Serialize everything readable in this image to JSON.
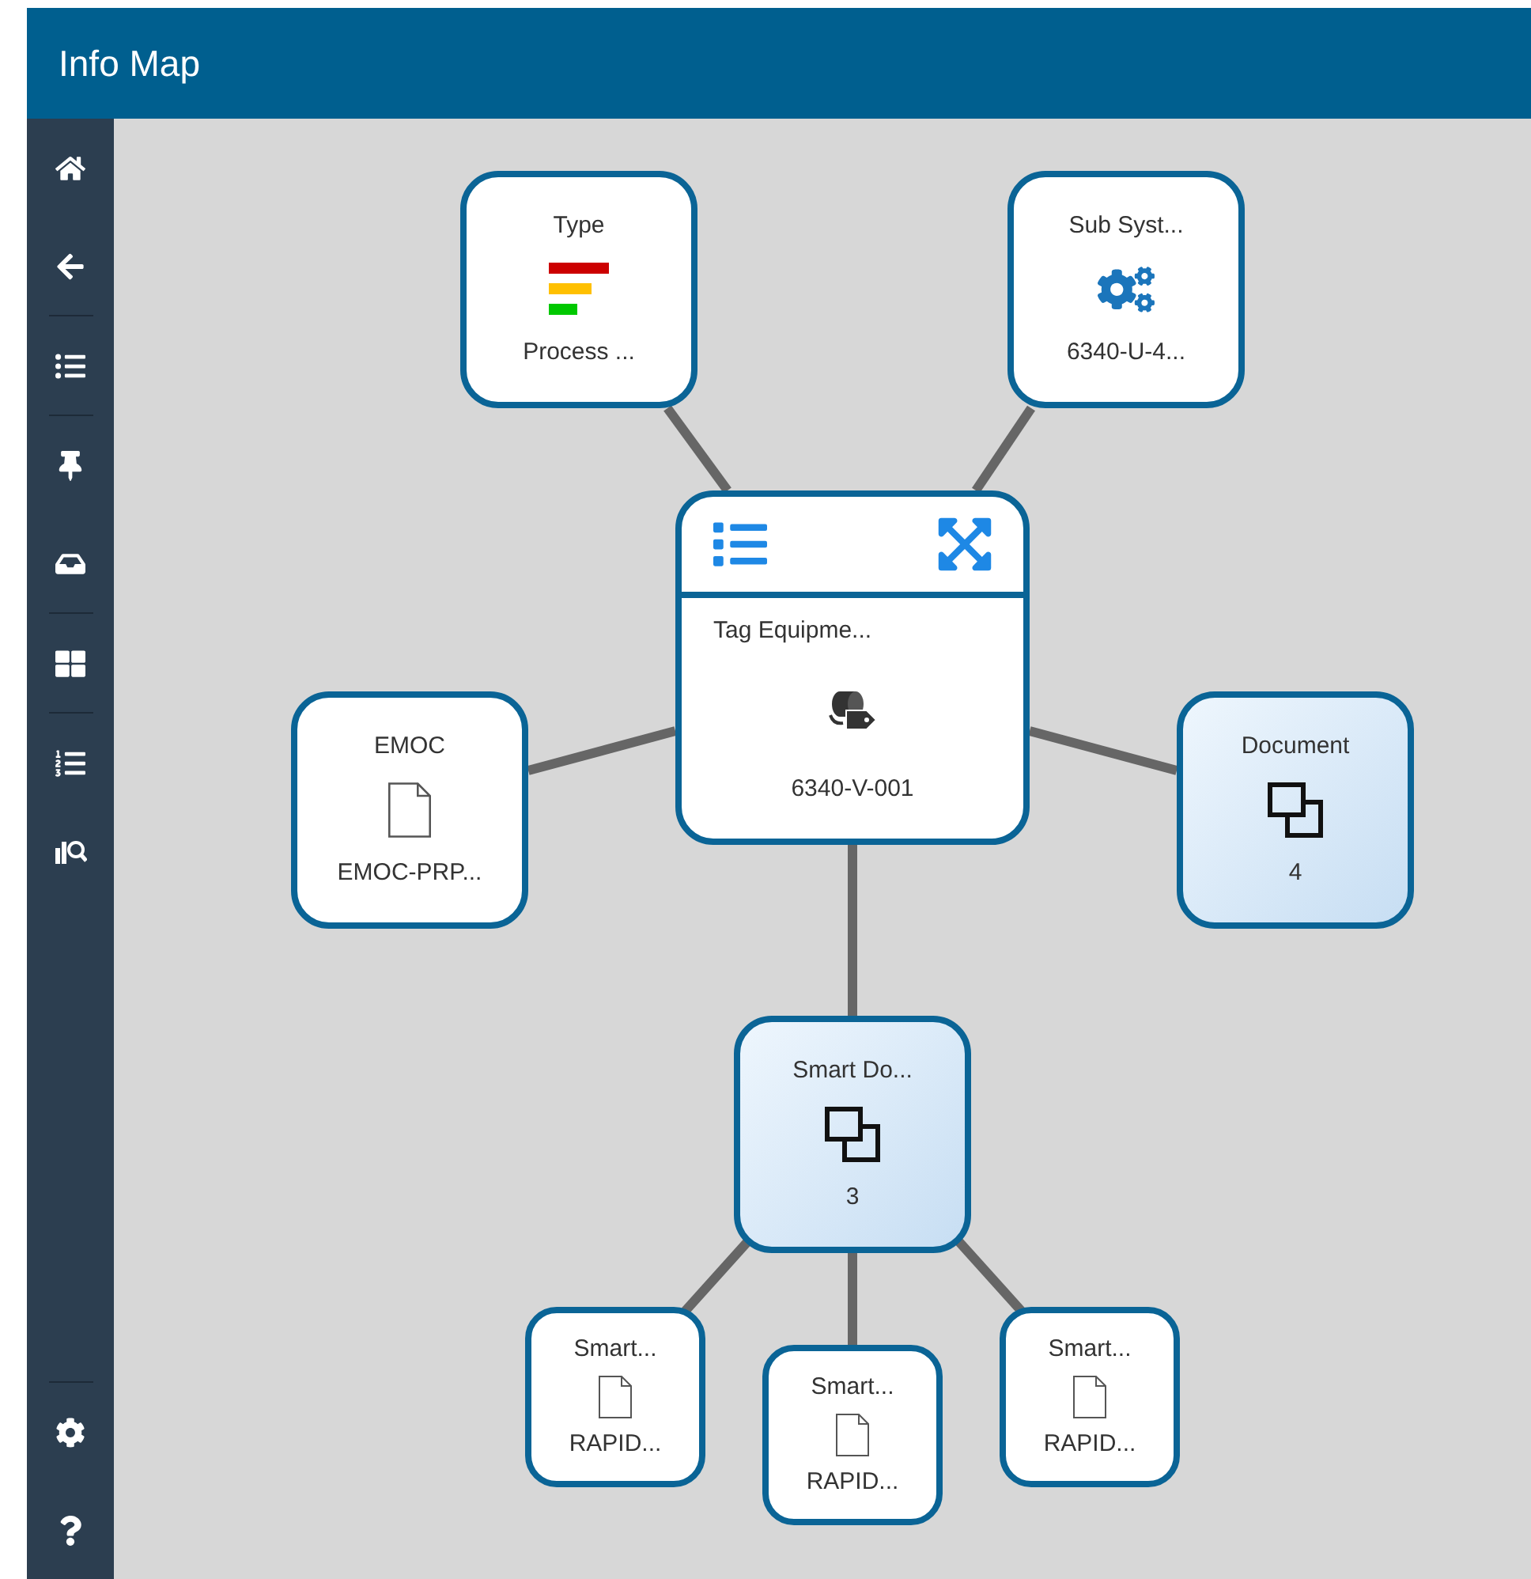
{
  "header": {
    "title": "Info Map"
  },
  "center": {
    "title": "Tag Equipme...",
    "value": "6340-V-001"
  },
  "neighbors": [
    {
      "title": "Type",
      "kind": "priority",
      "value": "Process ...",
      "highlighted": false
    },
    {
      "title": "Sub Syst...",
      "kind": "gears",
      "value": "6340-U-4...",
      "highlighted": false
    },
    {
      "title": "EMOC",
      "kind": "file",
      "value": "EMOC-PRP...",
      "highlighted": false
    },
    {
      "title": "Document",
      "kind": "stack",
      "value": "4",
      "highlighted": true
    },
    {
      "title": "Smart Do...",
      "kind": "stack",
      "value": "3",
      "highlighted": true,
      "children": [
        {
          "title": "Smart...",
          "kind": "file",
          "value": "RAPID...",
          "highlighted": false
        },
        {
          "title": "Smart...",
          "kind": "file",
          "value": "RAPID...",
          "highlighted": false
        },
        {
          "title": "Smart...",
          "kind": "file",
          "value": "RAPID...",
          "highlighted": false
        }
      ]
    }
  ]
}
